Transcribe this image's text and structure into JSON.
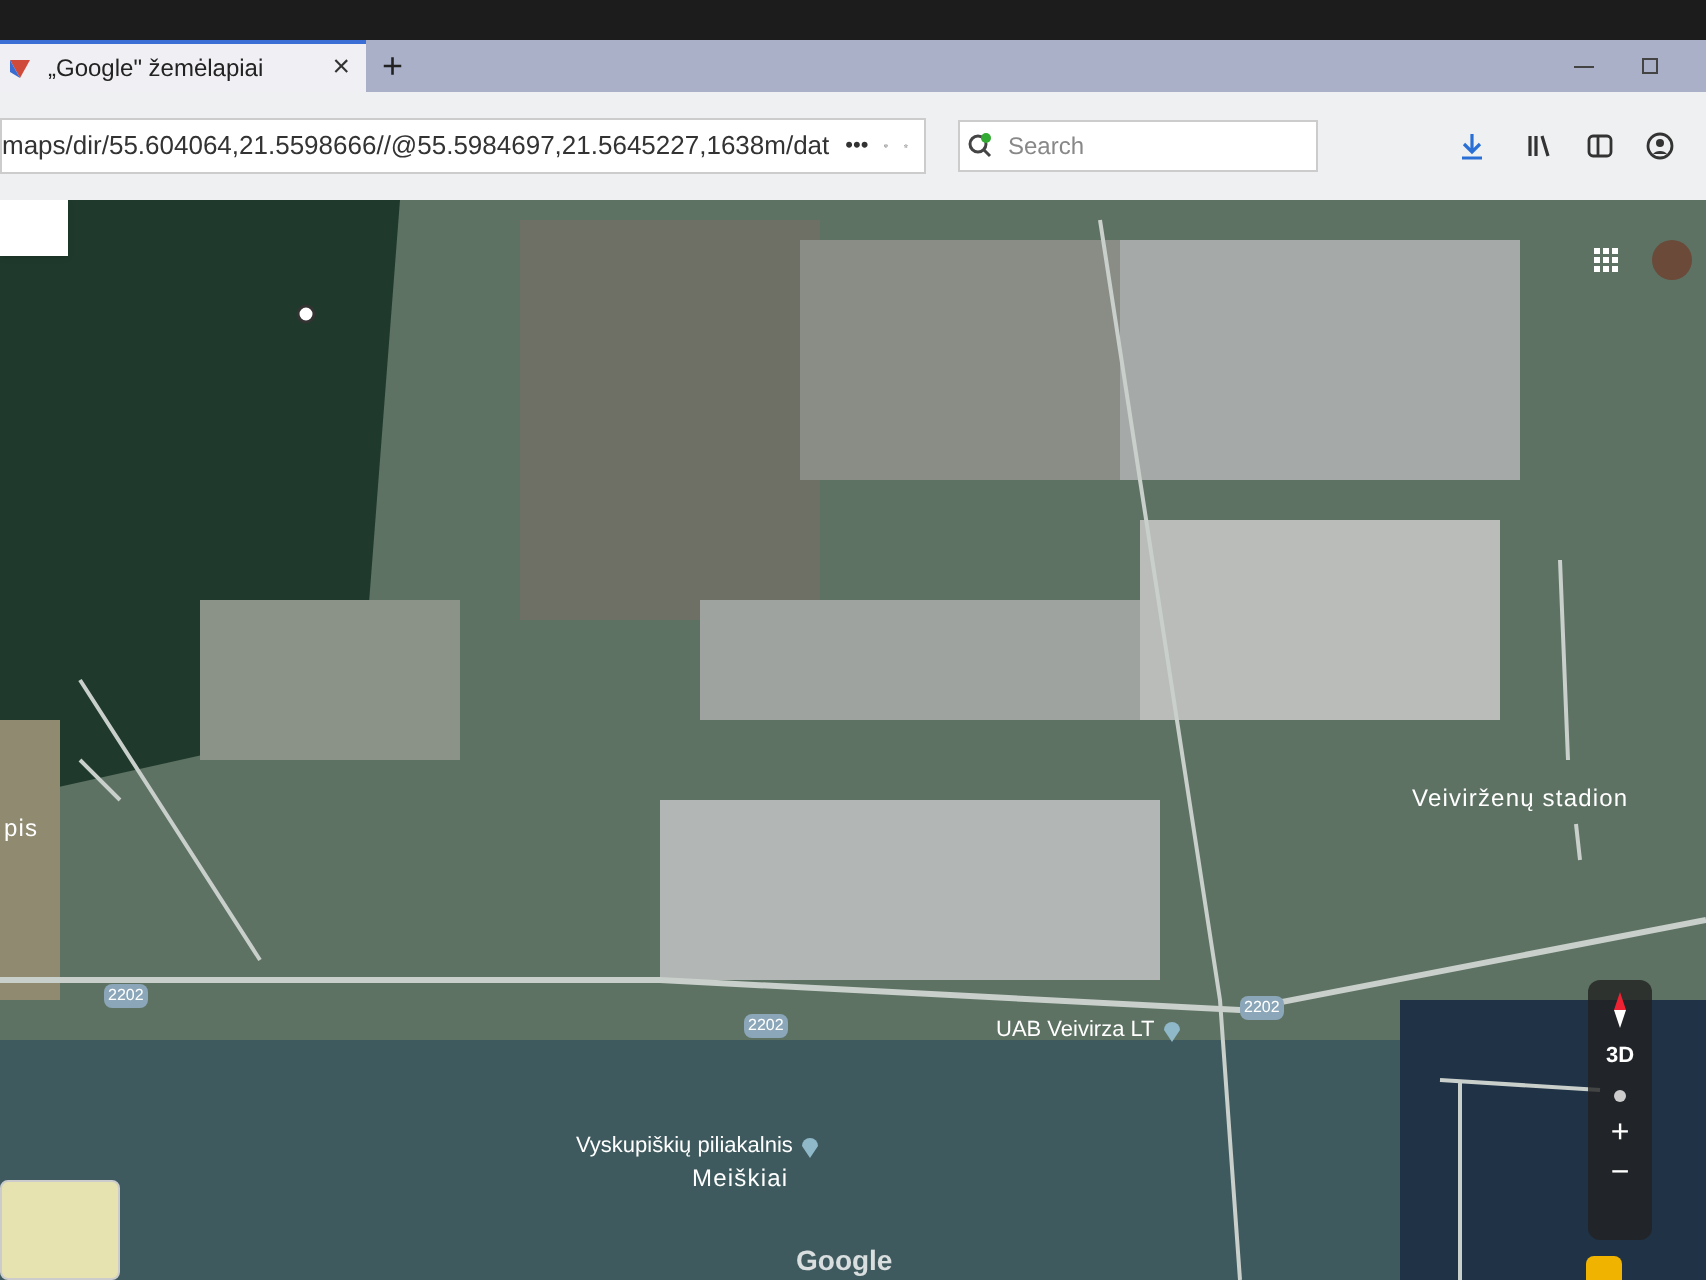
{
  "browser": {
    "tab": {
      "title": "„Google\" žemėlapiai",
      "close": "×"
    },
    "new_tab": "+",
    "address": "maps/dir/55.604064,21.5598666//@55.5984697,21.5645227,1638m/dat",
    "page_actions": "•••",
    "search": {
      "placeholder": "Search"
    }
  },
  "map": {
    "labels": [
      {
        "kind": "place",
        "text": "pis"
      },
      {
        "kind": "road",
        "text": "2202"
      },
      {
        "kind": "road",
        "text": "2202"
      },
      {
        "kind": "poi",
        "text": "UAB Veivirza LT"
      },
      {
        "kind": "road",
        "text": "2202"
      },
      {
        "kind": "place",
        "text": "Veivirženų stadion"
      },
      {
        "kind": "poi",
        "text": "Vyskupiškių piliakalnis"
      },
      {
        "kind": "place",
        "text": "Meiškiai"
      }
    ],
    "controls": {
      "tilt": "3D",
      "zoom_in": "+",
      "zoom_out": "−"
    },
    "logo": "Google"
  }
}
